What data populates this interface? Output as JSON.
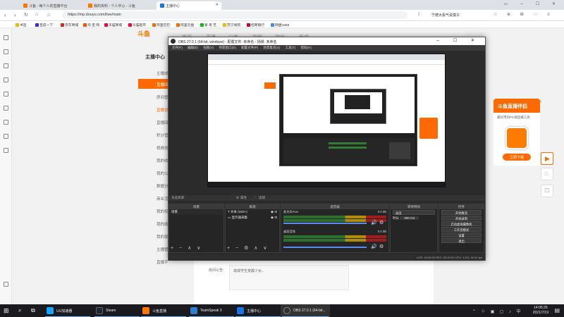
{
  "browser": {
    "tabs": [
      {
        "label": "斗鱼 - 每个人的直播平台",
        "color": "#ff7700"
      },
      {
        "label": "我的资料 - 个人中心 - 斗鱼",
        "color": "#ff7700"
      },
      {
        "label": "主播中心",
        "color": "#1a73e8"
      }
    ],
    "url": "https://mp.douyu.com/live/main",
    "url_right_text": "宁德大看气说猿子",
    "bookmarks": [
      "书签",
      "百度一下",
      "京东商城",
      "淘 宝 网",
      "天猫商城",
      "天猫超市",
      "阿里巴巴",
      "阿里云盘",
      "爱 奇 艺",
      "苏宁易购",
      "招商银行",
      "网盘1688"
    ],
    "bookmark_colors": [
      "#f4b400",
      "#2932e1",
      "#e1251b",
      "#ff5000",
      "#ff0036",
      "#ff0036",
      "#ff6a00",
      "#ff6a00",
      "#00be06",
      "#f7b500",
      "#d4001f",
      "#3a8ee6"
    ]
  },
  "site": {
    "logo": "斗鱼",
    "header_tabs": [
      "首页",
      "直播",
      "分类",
      "视频",
      "游戏",
      "鱼吧"
    ],
    "sidebar_title": "主播中心",
    "sidebar_items": [
      "主播成",
      "直播间",
      "房间管",
      "直播设",
      "直播回",
      "积分管",
      "视频创",
      "我的收",
      "我的公",
      "数据分",
      "商业活",
      "我的权",
      "我的勋",
      "我的家",
      "主播管",
      "直播手"
    ],
    "form_label": "房间公告:",
    "form_value": "戒戒学生变靓少女。",
    "ad_title": "斗鱼直播伴侣",
    "ad_sub": "最好用的PC端直播工具",
    "ad_button": "立即下载"
  },
  "obs": {
    "title": "OBS 27.0.1 (64-bit, windows) - 配置文件: 未命名 - 场景: 未命名",
    "menu": [
      "文件(F)",
      "编辑(E)",
      "视图(V)",
      "停靠窗口(D)",
      "配置文件(P)",
      "场景集合(S)",
      "工具(T)",
      "帮助(H)"
    ],
    "bar_label": "未选择源",
    "bar_props": "属性",
    "bar_filters": "滤镜",
    "docks": {
      "scenes": {
        "title": "场景",
        "items": [
          "场景"
        ]
      },
      "sources": {
        "title": "来源",
        "items": [
          "文本 (GDI+)",
          "显示器采集"
        ]
      },
      "mixer": {
        "title": "混音器",
        "channels": [
          {
            "name": "麦克风/Aux",
            "db": "0.0 dB"
          },
          {
            "name": "桌面音频",
            "db": "0.0 dB"
          }
        ]
      },
      "transitions": {
        "title": "转场特效",
        "type": "淡出",
        "duration_label": "时长",
        "duration": "300 ms"
      },
      "controls": {
        "title": "控件",
        "buttons": [
          "开始推流",
          "开始录制",
          "启动虚拟摄像机",
          "工作室模式",
          "设置",
          "退出"
        ]
      }
    },
    "status": "LIVE: 00:00:00   REC: 00:00:00   CPU: 1.2%, 30.00 fps"
  },
  "taskbar": {
    "items": [
      {
        "label": "UU加速器",
        "color": "#1aa3ff"
      },
      {
        "label": "Steam",
        "color": "#1b2838"
      },
      {
        "label": "斗鱼直播",
        "color": "#ff7700"
      },
      {
        "label": "TeamSpeak 3",
        "color": "#2f7bd0"
      },
      {
        "label": "主播中心",
        "color": "#1a73e8"
      },
      {
        "label": "OBS 27.0.1 (64-bit...",
        "color": "#302e31"
      }
    ],
    "time": "14:05:26",
    "date": "2021/7/19"
  }
}
